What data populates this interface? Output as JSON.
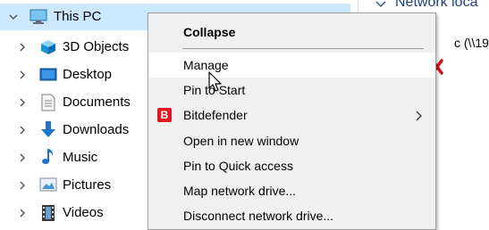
{
  "nav": {
    "items": [
      {
        "label": "This PC",
        "icon": "computer-icon",
        "expanded": true,
        "selected": true
      },
      {
        "label": "3D Objects",
        "icon": "3d-objects-icon"
      },
      {
        "label": "Desktop",
        "icon": "desktop-icon"
      },
      {
        "label": "Documents",
        "icon": "documents-icon"
      },
      {
        "label": "Downloads",
        "icon": "downloads-icon"
      },
      {
        "label": "Music",
        "icon": "music-icon"
      },
      {
        "label": "Pictures",
        "icon": "pictures-icon"
      },
      {
        "label": "Videos",
        "icon": "videos-icon"
      }
    ]
  },
  "right_pane": {
    "network_header": "Network loca",
    "path_text": "c (\\\\19"
  },
  "menu": {
    "items": [
      {
        "label": "Collapse",
        "bold": true
      },
      {
        "label": "Manage",
        "hover": true
      },
      {
        "label": "Pin to Start"
      },
      {
        "label": "Bitdefender",
        "icon": "bitdefender-icon",
        "icon_letter": "B",
        "submenu": true
      },
      {
        "label": "Open in new window"
      },
      {
        "label": "Pin to Quick access"
      },
      {
        "label": "Map network drive..."
      },
      {
        "label": "Disconnect network drive..."
      }
    ]
  },
  "colors": {
    "selection": "#cce8ff",
    "menu_bg": "#f0f0f0",
    "menu_hover": "#ffffff",
    "bitdefender_red": "#e01a22",
    "error_red": "#d4111b",
    "network_header_text": "#1e3f7a"
  }
}
